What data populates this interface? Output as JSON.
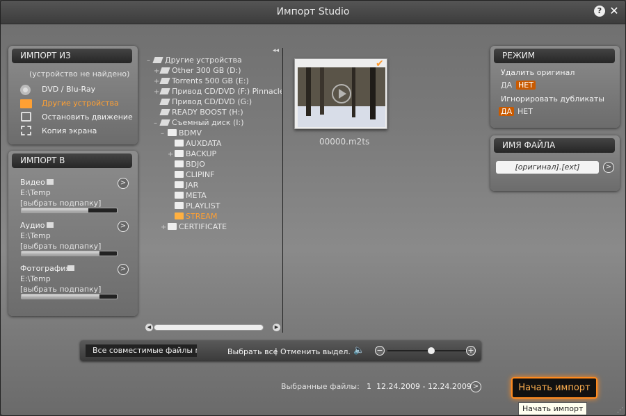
{
  "window": {
    "title": "Импорт Studio",
    "help": "?",
    "close": "✕"
  },
  "import_from": {
    "header": "ИМПОРТ ИЗ",
    "note": "(устройство не найдено)",
    "items": [
      "DVD / Blu-Ray",
      "Другие устройства",
      "Остановить движение",
      "Копия экрана"
    ]
  },
  "import_to": {
    "header": "ИМПОРТ В",
    "video": {
      "label": "Видео",
      "path": "E:\\Temp",
      "sub": "[выбрать подпапку]",
      "usage": 0.7
    },
    "audio": {
      "label": "Аудио",
      "path": "E:\\Temp",
      "sub": "[выбрать подпапку]",
      "usage": 0.82
    },
    "photo": {
      "label": "Фотография",
      "path": "E:\\Temp",
      "sub": "[выбрать подпапку]",
      "usage": 0.82
    }
  },
  "tree": {
    "collapse": "◂◂",
    "items": [
      {
        "exp": "–",
        "label": "Другие устройства",
        "type": "pc"
      },
      {
        "exp": "+",
        "label": "Other 300 GB (D:)",
        "type": "drive"
      },
      {
        "exp": "+",
        "label": "Torrents 500 GB (E:)",
        "type": "drive"
      },
      {
        "exp": "+",
        "label": "Привод CD/DVD (F:) Pinnacle S",
        "type": "drive"
      },
      {
        "exp": "",
        "label": "Привод CD/DVD (G:)",
        "type": "drive"
      },
      {
        "exp": "",
        "label": "READY BOOST (H:)",
        "type": "drive"
      },
      {
        "exp": "–",
        "label": "Съемный диск (I:)",
        "type": "drive"
      },
      {
        "exp": "–",
        "label": "BDMV",
        "type": "folder"
      },
      {
        "exp": "",
        "label": "AUXDATA",
        "type": "folder"
      },
      {
        "exp": "+",
        "label": "BACKUP",
        "type": "folder"
      },
      {
        "exp": "",
        "label": "BDJO",
        "type": "folder"
      },
      {
        "exp": "",
        "label": "CLIPINF",
        "type": "folder"
      },
      {
        "exp": "",
        "label": "JAR",
        "type": "folder"
      },
      {
        "exp": "",
        "label": "META",
        "type": "folder"
      },
      {
        "exp": "",
        "label": "PLAYLIST",
        "type": "folder"
      },
      {
        "exp": "",
        "label": "STREAM",
        "type": "folder",
        "selected": true
      },
      {
        "exp": "+",
        "label": "CERTIFICATE",
        "type": "folder"
      }
    ]
  },
  "thumb": {
    "name": "00000.m2ts",
    "checked": true
  },
  "mode": {
    "header": "РЕЖИМ",
    "delete_label": "Удалить оригинал",
    "delete_yes": "ДА",
    "delete_no": "НЕТ",
    "dup_label": "Игнорировать дубликаты",
    "dup_yes": "ДА",
    "dup_no": "НЕТ"
  },
  "filename": {
    "header": "ИМЯ ФАЙЛА",
    "value": "[оригинал].[ext]"
  },
  "toolbar": {
    "filter": "Все совместимые файлы мули",
    "select_all": "Выбрать все",
    "sep": "|",
    "deselect": "Отменить выдел.",
    "zoom": 0.55
  },
  "status": {
    "label": "Выбранные файлы:",
    "count": "1",
    "range": "12.24.2009 - 12.24.2009"
  },
  "start": {
    "label": "Начать импорт",
    "tooltip": "Начать импорт"
  },
  "colors": {
    "accent": "#ff9a2e",
    "panel": "#7c7c7c"
  }
}
